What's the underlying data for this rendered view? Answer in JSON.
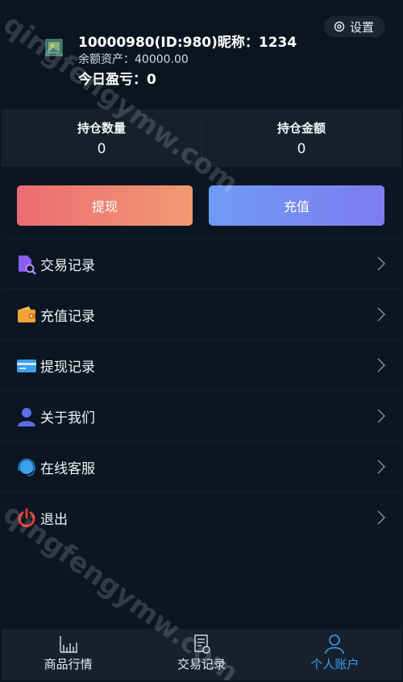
{
  "header": {
    "settings_label": "设置",
    "user_line": "10000980(ID:980)昵称：1234",
    "balance_line": "余额资产：40000.00",
    "pnl_line": "今日盈亏：0"
  },
  "stats": [
    {
      "label": "持仓数量",
      "value": "0"
    },
    {
      "label": "持仓金额",
      "value": "0"
    }
  ],
  "actions": {
    "withdraw_label": "提现",
    "recharge_label": "充值"
  },
  "menu": [
    {
      "label": "交易记录",
      "icon": "trade-record-icon"
    },
    {
      "label": "充值记录",
      "icon": "wallet-icon"
    },
    {
      "label": "提现记录",
      "icon": "card-icon"
    },
    {
      "label": "关于我们",
      "icon": "user-icon"
    },
    {
      "label": "在线客服",
      "icon": "support-icon"
    },
    {
      "label": "退出",
      "icon": "power-icon"
    }
  ],
  "tabbar": [
    {
      "label": "商品行情",
      "icon": "chart-icon",
      "active": false
    },
    {
      "label": "交易记录",
      "icon": "document-icon",
      "active": false
    },
    {
      "label": "个人账户",
      "icon": "user-icon",
      "active": true
    }
  ],
  "watermark": "qingfengymw.com",
  "colors": {
    "background": "#0b1622",
    "withdraw_gradient": [
      "#ec6b72",
      "#f09a72"
    ],
    "recharge_gradient": [
      "#6e9bf5",
      "#7e7cf0"
    ],
    "active_tab": "#3d9cf0"
  }
}
